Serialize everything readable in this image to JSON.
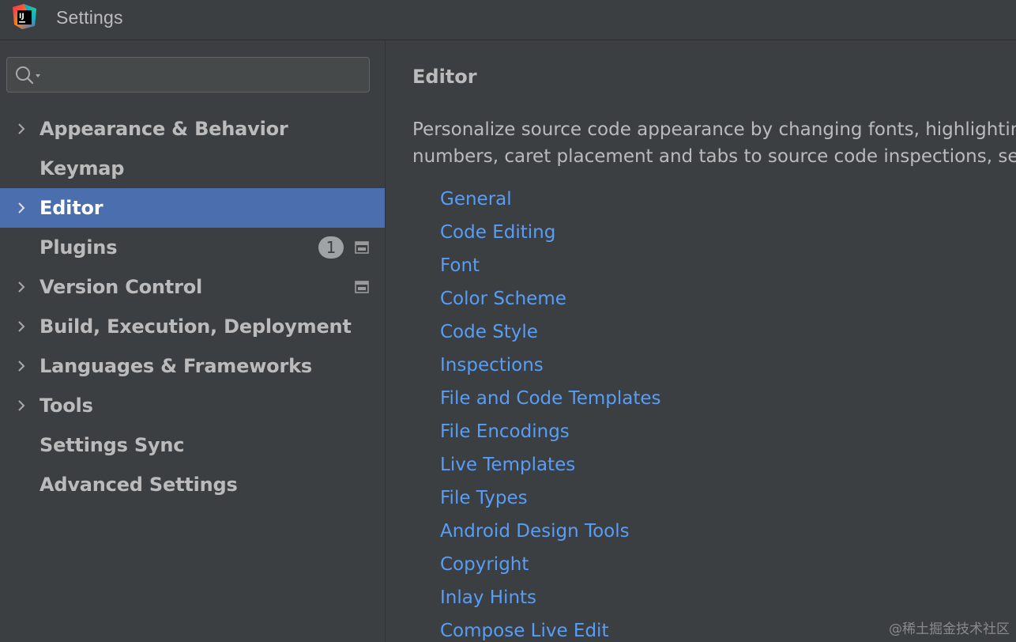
{
  "window": {
    "title": "Settings",
    "app_icon_text": "IJ"
  },
  "sidebar": {
    "search": {
      "value": "",
      "placeholder": ""
    },
    "items": [
      {
        "label": "Appearance & Behavior",
        "expandable": true
      },
      {
        "label": "Keymap",
        "expandable": false
      },
      {
        "label": "Editor",
        "expandable": true,
        "selected": true
      },
      {
        "label": "Plugins",
        "expandable": false,
        "badge": "1",
        "window_icon": true
      },
      {
        "label": "Version Control",
        "expandable": true,
        "window_icon": true
      },
      {
        "label": "Build, Execution, Deployment",
        "expandable": true
      },
      {
        "label": "Languages & Frameworks",
        "expandable": true
      },
      {
        "label": "Tools",
        "expandable": true
      },
      {
        "label": "Settings Sync",
        "expandable": false
      },
      {
        "label": "Advanced Settings",
        "expandable": false
      }
    ]
  },
  "content": {
    "title": "Editor",
    "description_line1": "Personalize source code appearance by changing fonts, highlightin",
    "description_line2": "numbers, caret placement and tabs to source code inspections, set",
    "links": [
      "General",
      "Code Editing",
      "Font",
      "Color Scheme",
      "Code Style",
      "Inspections",
      "File and Code Templates",
      "File Encodings",
      "Live Templates",
      "File Types",
      "Android Design Tools",
      "Copyright",
      "Inlay Hints",
      "Compose Live Edit"
    ]
  },
  "watermark": "@稀土掘金技术社区",
  "colors": {
    "background": "#3c3f41",
    "selection": "#4b6eaf",
    "link": "#589df6",
    "text": "#bbbbbb"
  }
}
